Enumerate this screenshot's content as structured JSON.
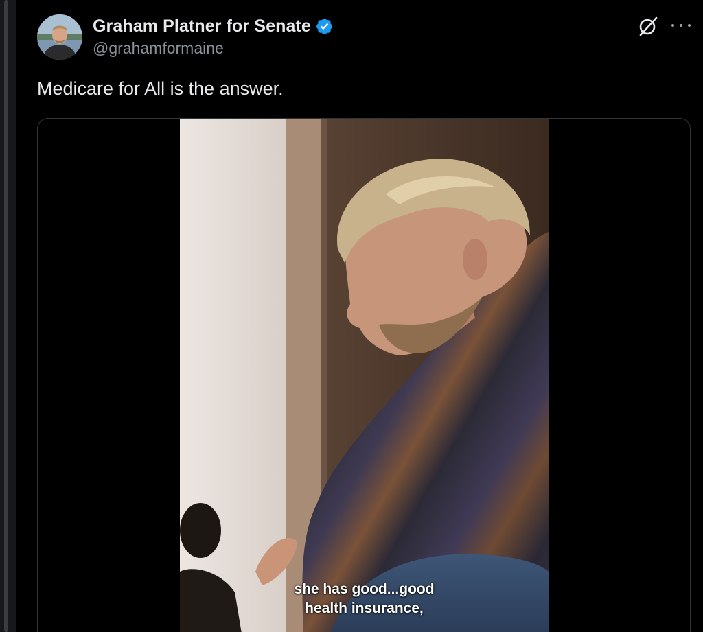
{
  "post": {
    "author": {
      "display_name": "Graham Platner for Senate",
      "handle": "@grahamformaine",
      "verified": true
    },
    "text": "Medicare for All is the answer.",
    "media": {
      "type": "video",
      "caption_line_1": "she has good...good",
      "caption_line_2": "health insurance,"
    },
    "icons": {
      "grok": "grok-icon",
      "more": "more-options-icon",
      "verified": "verified-badge-icon"
    }
  },
  "colors": {
    "background": "#000000",
    "text_primary": "#e7e9ea",
    "text_secondary": "#8b9198",
    "verified_blue": "#1d9bf0",
    "card_border": "#333639"
  }
}
